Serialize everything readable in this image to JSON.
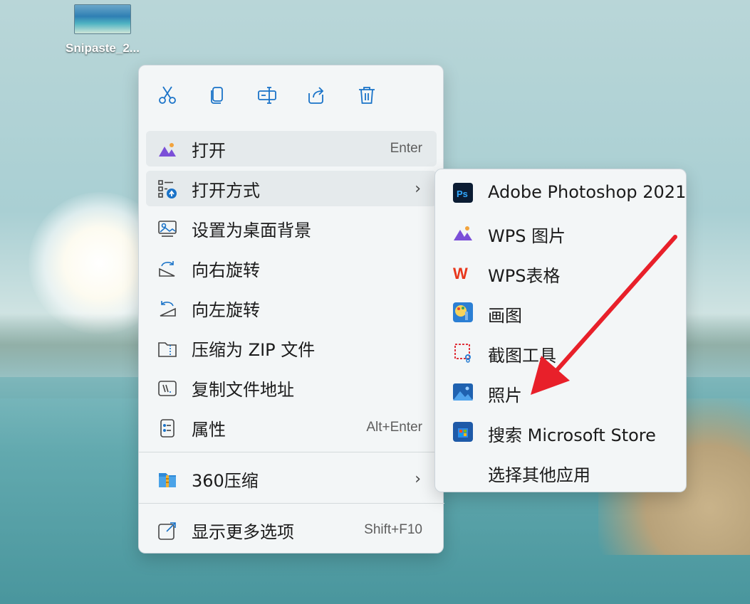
{
  "desktop": {
    "icon_label": "Snipaste_2..."
  },
  "toolbar": {
    "cut_icon": "scissors-icon",
    "copy_icon": "copy-icon",
    "rename_icon": "rename-icon",
    "share_icon": "share-icon",
    "delete_icon": "trash-icon"
  },
  "menu": {
    "items": [
      {
        "label": "打开",
        "shortcut": "Enter",
        "icon": "wps-photo-icon"
      },
      {
        "label": "打开方式",
        "chevron": "›",
        "icon": "open-with-icon"
      },
      {
        "label": "设置为桌面背景",
        "icon": "wallpaper-icon"
      },
      {
        "label": "向右旋转",
        "icon": "rotate-right-icon"
      },
      {
        "label": "向左旋转",
        "icon": "rotate-left-icon"
      },
      {
        "label": "压缩为 ZIP 文件",
        "icon": "zip-icon"
      },
      {
        "label": "复制文件地址",
        "icon": "copy-path-icon"
      },
      {
        "label": "属性",
        "shortcut": "Alt+Enter",
        "icon": "properties-icon"
      }
    ],
    "extra": {
      "label": "360压缩",
      "chevron": "›",
      "icon": "360-zip-icon"
    },
    "more": {
      "label": "显示更多选项",
      "shortcut": "Shift+F10",
      "icon": "more-options-icon"
    }
  },
  "submenu": {
    "items": [
      {
        "label": "Adobe Photoshop 2021",
        "icon": "photoshop-icon"
      },
      {
        "label": "WPS 图片",
        "icon": "wps-photo-icon"
      },
      {
        "label": "WPS表格",
        "icon": "wps-sheet-icon"
      },
      {
        "label": "画图",
        "icon": "paint-icon"
      },
      {
        "label": "截图工具",
        "icon": "snipping-tool-icon"
      },
      {
        "label": "照片",
        "icon": "photos-icon"
      },
      {
        "label": "搜索 Microsoft Store",
        "icon": "store-icon"
      },
      {
        "label": "选择其他应用",
        "icon": ""
      }
    ]
  },
  "colors": {
    "accent": "#1a73c8",
    "arrow": "#e8202a",
    "menu_bg": "#f3f6f7"
  }
}
